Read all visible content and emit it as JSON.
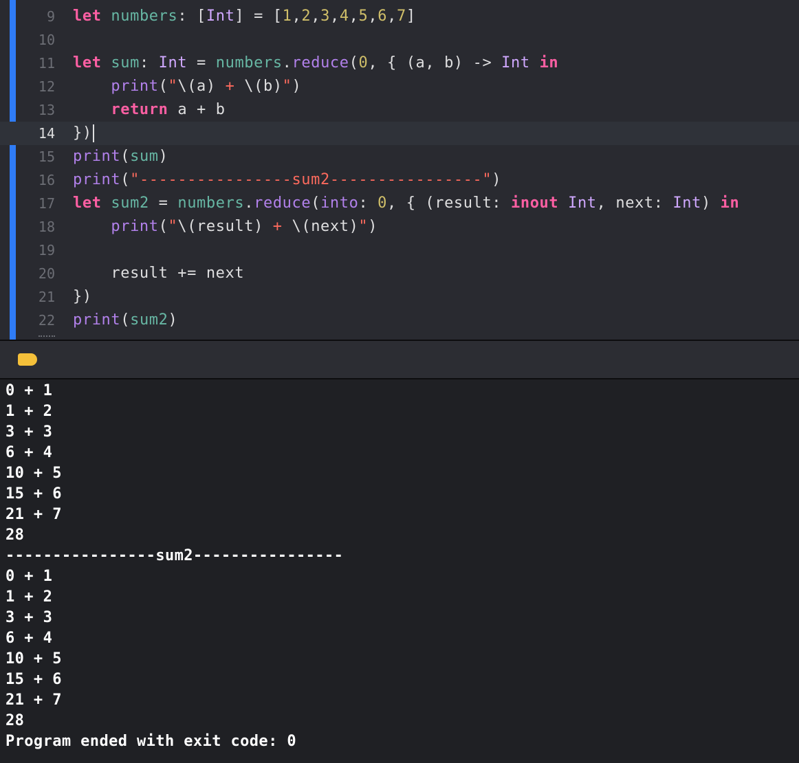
{
  "editor": {
    "lines": [
      {
        "num": "9",
        "tokens": [
          [
            "kw",
            "let"
          ],
          [
            "pl",
            " "
          ],
          [
            "id",
            "numbers"
          ],
          [
            "pl",
            ": ["
          ],
          [
            "ty",
            "Int"
          ],
          [
            "pl",
            "] = ["
          ],
          [
            "nu",
            "1"
          ],
          [
            "pl",
            ","
          ],
          [
            "nu",
            "2"
          ],
          [
            "pl",
            ","
          ],
          [
            "nu",
            "3"
          ],
          [
            "pl",
            ","
          ],
          [
            "nu",
            "4"
          ],
          [
            "pl",
            ","
          ],
          [
            "nu",
            "5"
          ],
          [
            "pl",
            ","
          ],
          [
            "nu",
            "6"
          ],
          [
            "pl",
            ","
          ],
          [
            "nu",
            "7"
          ],
          [
            "pl",
            "]"
          ]
        ]
      },
      {
        "num": "10",
        "tokens": []
      },
      {
        "num": "11",
        "tokens": [
          [
            "kw",
            "let"
          ],
          [
            "pl",
            " "
          ],
          [
            "id",
            "sum"
          ],
          [
            "pl",
            ": "
          ],
          [
            "ty",
            "Int"
          ],
          [
            "pl",
            " = "
          ],
          [
            "id",
            "numbers"
          ],
          [
            "pl",
            "."
          ],
          [
            "fn",
            "reduce"
          ],
          [
            "pl",
            "("
          ],
          [
            "nu",
            "0"
          ],
          [
            "pl",
            ", { (a, b) -> "
          ],
          [
            "ty",
            "Int"
          ],
          [
            "pl",
            " "
          ],
          [
            "kw",
            "in"
          ]
        ]
      },
      {
        "num": "12",
        "tokens": [
          [
            "pl",
            "    "
          ],
          [
            "fn",
            "print"
          ],
          [
            "pl",
            "("
          ],
          [
            "st",
            "\""
          ],
          [
            "pl",
            "\\(a)"
          ],
          [
            "st",
            " + "
          ],
          [
            "pl",
            "\\(b)"
          ],
          [
            "st",
            "\""
          ],
          [
            "pl",
            ")"
          ]
        ]
      },
      {
        "num": "13",
        "tokens": [
          [
            "pl",
            "    "
          ],
          [
            "kw",
            "return"
          ],
          [
            "pl",
            " a + b"
          ]
        ]
      },
      {
        "num": "14",
        "tokens": [
          [
            "pl",
            "})"
          ]
        ],
        "current": true
      },
      {
        "num": "15",
        "tokens": [
          [
            "fn",
            "print"
          ],
          [
            "pl",
            "("
          ],
          [
            "id",
            "sum"
          ],
          [
            "pl",
            ")"
          ]
        ]
      },
      {
        "num": "16",
        "tokens": [
          [
            "fn",
            "print"
          ],
          [
            "pl",
            "("
          ],
          [
            "st",
            "\"----------------sum2----------------\""
          ],
          [
            "pl",
            ")"
          ]
        ]
      },
      {
        "num": "17",
        "tokens": [
          [
            "kw",
            "let"
          ],
          [
            "pl",
            " "
          ],
          [
            "id",
            "sum2"
          ],
          [
            "pl",
            " = "
          ],
          [
            "id",
            "numbers"
          ],
          [
            "pl",
            "."
          ],
          [
            "fn",
            "reduce"
          ],
          [
            "pl",
            "("
          ],
          [
            "fn",
            "into"
          ],
          [
            "pl",
            ": "
          ],
          [
            "nu",
            "0"
          ],
          [
            "pl",
            ", { (result: "
          ],
          [
            "kw",
            "inout"
          ],
          [
            "pl",
            " "
          ],
          [
            "ty",
            "Int"
          ],
          [
            "pl",
            ", next: "
          ],
          [
            "ty",
            "Int"
          ],
          [
            "pl",
            ") "
          ],
          [
            "kw",
            "in"
          ]
        ]
      },
      {
        "num": "18",
        "tokens": [
          [
            "pl",
            "    "
          ],
          [
            "fn",
            "print"
          ],
          [
            "pl",
            "("
          ],
          [
            "st",
            "\""
          ],
          [
            "pl",
            "\\(result)"
          ],
          [
            "st",
            " + "
          ],
          [
            "pl",
            "\\(next)"
          ],
          [
            "st",
            "\""
          ],
          [
            "pl",
            ")"
          ]
        ]
      },
      {
        "num": "19",
        "tokens": []
      },
      {
        "num": "20",
        "tokens": [
          [
            "pl",
            "    result += next"
          ]
        ]
      },
      {
        "num": "21",
        "tokens": [
          [
            "pl",
            "})"
          ]
        ]
      },
      {
        "num": "22",
        "tokens": [
          [
            "fn",
            "print"
          ],
          [
            "pl",
            "("
          ],
          [
            "id",
            "sum2"
          ],
          [
            "pl",
            ")"
          ]
        ]
      }
    ]
  },
  "debug_bar": {
    "tag_color": "#f5c03a"
  },
  "console": {
    "lines": [
      "0 + 1",
      "1 + 2",
      "3 + 3",
      "6 + 4",
      "10 + 5",
      "15 + 6",
      "21 + 7",
      "28",
      "----------------sum2----------------",
      "0 + 1",
      "1 + 2",
      "3 + 3",
      "6 + 4",
      "10 + 5",
      "15 + 6",
      "21 + 7",
      "28",
      "Program ended with exit code: 0"
    ]
  }
}
